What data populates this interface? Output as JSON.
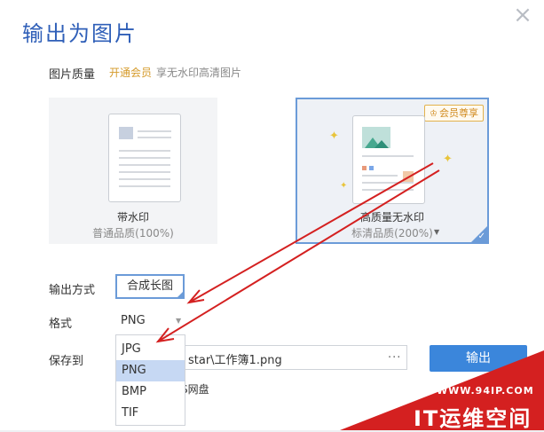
{
  "dialog": {
    "title": "输出为图片",
    "close_glyph": "×"
  },
  "quality": {
    "label": "图片质量",
    "vip_link": "开通会员",
    "vip_tip": "享无水印高清图片"
  },
  "cards": [
    {
      "title": "带水印",
      "subtitle": "普通品质(100%)"
    },
    {
      "title": "高质量无水印",
      "subtitle": "标清品质(200%)",
      "badge": "会员尊享",
      "selected": true
    }
  ],
  "output_mode": {
    "label": "输出方式",
    "value": "合成长图"
  },
  "format": {
    "label": "格式",
    "value": "PNG",
    "options": [
      "JPG",
      "PNG",
      "BMP",
      "TIF"
    ],
    "selected": "PNG"
  },
  "save": {
    "label": "保存到",
    "path_visible": "star\\工作簿1.png",
    "more": "...",
    "cloud_visible": "S网盘"
  },
  "export_button": "输出",
  "watermark": {
    "url": "WWW.94IP.COM",
    "brand": "IT运维空间"
  },
  "colors": {
    "accent": "#3b86db",
    "title": "#2f5fb8",
    "vip": "#d59a2a",
    "arrow": "#d42020"
  }
}
